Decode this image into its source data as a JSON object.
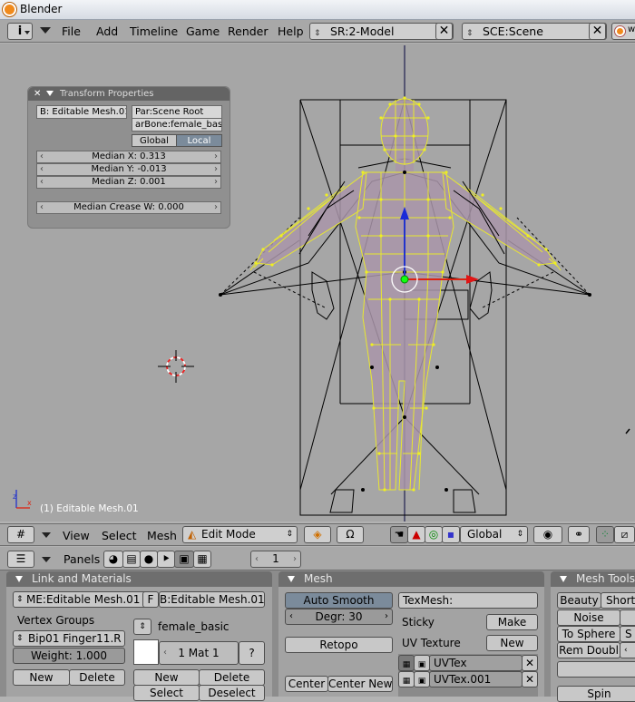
{
  "window": {
    "title": "Blender"
  },
  "menubar": {
    "menus": [
      "File",
      "Add",
      "Timeline",
      "Game",
      "Render",
      "Help"
    ],
    "screen_field": "SR:2-Model",
    "scene_field": "SCE:Scene",
    "clipped_label": "w"
  },
  "transform_panel": {
    "title": "Transform Properties",
    "name_field": "B: Editable Mesh.01",
    "parent_field": "Par:Scene Root",
    "bone_field": "arBone:female_basic",
    "global_label": "Global",
    "local_label": "Local",
    "median_x": "Median X: 0.313",
    "median_y": "Median Y: -0.013",
    "median_z": "Median Z: 0.001",
    "median_crease": "Median Crease W: 0.000"
  },
  "viewport": {
    "object_label": "(1) Editable Mesh.01"
  },
  "header3d": {
    "view": "View",
    "select": "Select",
    "mesh": "Mesh",
    "mode": "Edit Mode",
    "orientation": "Global"
  },
  "buttons_header": {
    "panels_label": "Panels",
    "frame": "1"
  },
  "link_materials": {
    "title": "Link and Materials",
    "mesh_name": "ME:Editable Mesh.01",
    "f_label": "F",
    "object_name": "B:Editable Mesh.01",
    "vertex_groups_label": "Vertex Groups",
    "vgroup_name": "Bip01 Finger11.R",
    "weight": "Weight: 1.000",
    "new_label": "New",
    "delete_label": "Delete",
    "material_name": "female_basic",
    "mat_slot": "1 Mat 1",
    "question": "?",
    "mat_new": "New",
    "mat_delete": "Delete",
    "select_label": "Select",
    "deselect_label": "Deselect"
  },
  "mesh_panel": {
    "title": "Mesh",
    "auto_smooth": "Auto Smooth",
    "degr": "Degr: 30",
    "retopo": "Retopo",
    "center": "Center",
    "center_new": "Center New",
    "texmesh": "TexMesh:",
    "sticky": "Sticky",
    "make": "Make",
    "uv_texture": "UV Texture",
    "uv_new": "New",
    "uvtex_list": [
      "UVTex",
      "UVTex.001"
    ]
  },
  "mesh_tools": {
    "title": "Mesh Tools",
    "beauty": "Beauty",
    "short": "Short",
    "noise": "Noise",
    "to_sphere": "To Sphere",
    "rem_doubl": "Rem Doubl",
    "spin": "Spin"
  },
  "colors": {
    "selected_wire": "#e8e830",
    "wire": "#000000",
    "skin": "#a995a9",
    "active_button": "#7b8b9b"
  }
}
